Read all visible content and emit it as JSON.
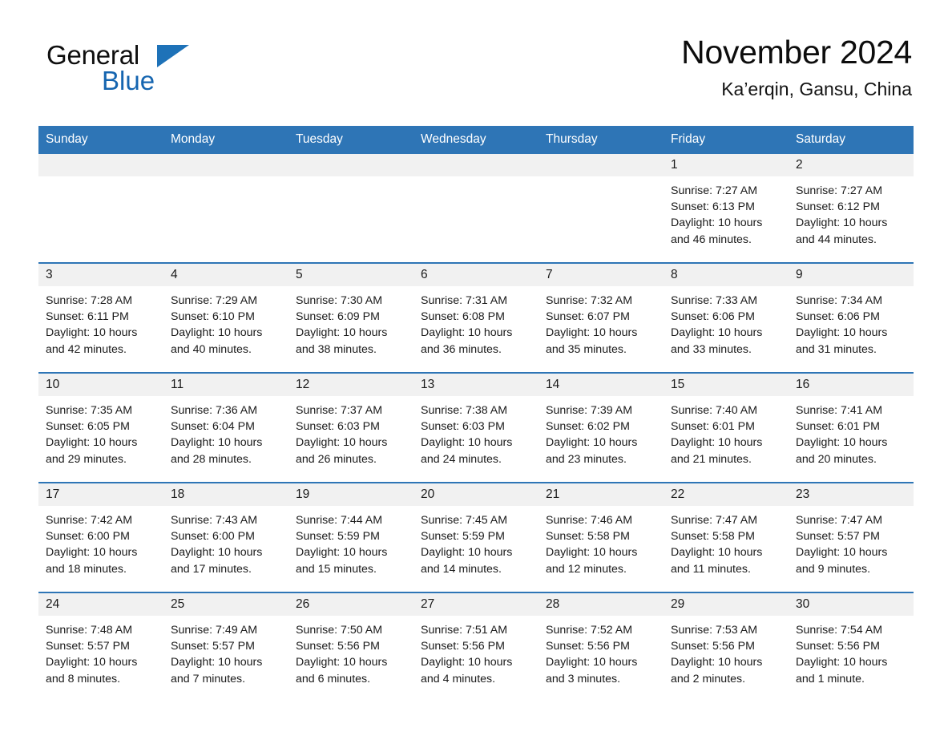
{
  "brand": {
    "name_part1": "General",
    "name_part2": "Blue",
    "logo_icon": "triangle-flag-icon",
    "accent_color": "#1e72b8"
  },
  "header": {
    "title": "November 2024",
    "subtitle": "Ka’erqin, Gansu, China"
  },
  "theme": {
    "header_row_color": "#2e75b6",
    "daynum_band_color": "#f1f1f1",
    "cell_border_color": "#2e75b6",
    "page_background": "#ffffff"
  },
  "weekday_headers": [
    "Sunday",
    "Monday",
    "Tuesday",
    "Wednesday",
    "Thursday",
    "Friday",
    "Saturday"
  ],
  "labels": {
    "sunrise_prefix": "Sunrise:",
    "sunset_prefix": "Sunset:",
    "daylight_prefix": "Daylight:"
  },
  "weeks": [
    [
      {
        "day": "",
        "empty": true
      },
      {
        "day": "",
        "empty": true
      },
      {
        "day": "",
        "empty": true
      },
      {
        "day": "",
        "empty": true
      },
      {
        "day": "",
        "empty": true
      },
      {
        "day": "1",
        "sunrise": "Sunrise: 7:27 AM",
        "sunset": "Sunset: 6:13 PM",
        "daylight": "Daylight: 10 hours and 46 minutes."
      },
      {
        "day": "2",
        "sunrise": "Sunrise: 7:27 AM",
        "sunset": "Sunset: 6:12 PM",
        "daylight": "Daylight: 10 hours and 44 minutes."
      }
    ],
    [
      {
        "day": "3",
        "sunrise": "Sunrise: 7:28 AM",
        "sunset": "Sunset: 6:11 PM",
        "daylight": "Daylight: 10 hours and 42 minutes."
      },
      {
        "day": "4",
        "sunrise": "Sunrise: 7:29 AM",
        "sunset": "Sunset: 6:10 PM",
        "daylight": "Daylight: 10 hours and 40 minutes."
      },
      {
        "day": "5",
        "sunrise": "Sunrise: 7:30 AM",
        "sunset": "Sunset: 6:09 PM",
        "daylight": "Daylight: 10 hours and 38 minutes."
      },
      {
        "day": "6",
        "sunrise": "Sunrise: 7:31 AM",
        "sunset": "Sunset: 6:08 PM",
        "daylight": "Daylight: 10 hours and 36 minutes."
      },
      {
        "day": "7",
        "sunrise": "Sunrise: 7:32 AM",
        "sunset": "Sunset: 6:07 PM",
        "daylight": "Daylight: 10 hours and 35 minutes."
      },
      {
        "day": "8",
        "sunrise": "Sunrise: 7:33 AM",
        "sunset": "Sunset: 6:06 PM",
        "daylight": "Daylight: 10 hours and 33 minutes."
      },
      {
        "day": "9",
        "sunrise": "Sunrise: 7:34 AM",
        "sunset": "Sunset: 6:06 PM",
        "daylight": "Daylight: 10 hours and 31 minutes."
      }
    ],
    [
      {
        "day": "10",
        "sunrise": "Sunrise: 7:35 AM",
        "sunset": "Sunset: 6:05 PM",
        "daylight": "Daylight: 10 hours and 29 minutes."
      },
      {
        "day": "11",
        "sunrise": "Sunrise: 7:36 AM",
        "sunset": "Sunset: 6:04 PM",
        "daylight": "Daylight: 10 hours and 28 minutes."
      },
      {
        "day": "12",
        "sunrise": "Sunrise: 7:37 AM",
        "sunset": "Sunset: 6:03 PM",
        "daylight": "Daylight: 10 hours and 26 minutes."
      },
      {
        "day": "13",
        "sunrise": "Sunrise: 7:38 AM",
        "sunset": "Sunset: 6:03 PM",
        "daylight": "Daylight: 10 hours and 24 minutes."
      },
      {
        "day": "14",
        "sunrise": "Sunrise: 7:39 AM",
        "sunset": "Sunset: 6:02 PM",
        "daylight": "Daylight: 10 hours and 23 minutes."
      },
      {
        "day": "15",
        "sunrise": "Sunrise: 7:40 AM",
        "sunset": "Sunset: 6:01 PM",
        "daylight": "Daylight: 10 hours and 21 minutes."
      },
      {
        "day": "16",
        "sunrise": "Sunrise: 7:41 AM",
        "sunset": "Sunset: 6:01 PM",
        "daylight": "Daylight: 10 hours and 20 minutes."
      }
    ],
    [
      {
        "day": "17",
        "sunrise": "Sunrise: 7:42 AM",
        "sunset": "Sunset: 6:00 PM",
        "daylight": "Daylight: 10 hours and 18 minutes."
      },
      {
        "day": "18",
        "sunrise": "Sunrise: 7:43 AM",
        "sunset": "Sunset: 6:00 PM",
        "daylight": "Daylight: 10 hours and 17 minutes."
      },
      {
        "day": "19",
        "sunrise": "Sunrise: 7:44 AM",
        "sunset": "Sunset: 5:59 PM",
        "daylight": "Daylight: 10 hours and 15 minutes."
      },
      {
        "day": "20",
        "sunrise": "Sunrise: 7:45 AM",
        "sunset": "Sunset: 5:59 PM",
        "daylight": "Daylight: 10 hours and 14 minutes."
      },
      {
        "day": "21",
        "sunrise": "Sunrise: 7:46 AM",
        "sunset": "Sunset: 5:58 PM",
        "daylight": "Daylight: 10 hours and 12 minutes."
      },
      {
        "day": "22",
        "sunrise": "Sunrise: 7:47 AM",
        "sunset": "Sunset: 5:58 PM",
        "daylight": "Daylight: 10 hours and 11 minutes."
      },
      {
        "day": "23",
        "sunrise": "Sunrise: 7:47 AM",
        "sunset": "Sunset: 5:57 PM",
        "daylight": "Daylight: 10 hours and 9 minutes."
      }
    ],
    [
      {
        "day": "24",
        "sunrise": "Sunrise: 7:48 AM",
        "sunset": "Sunset: 5:57 PM",
        "daylight": "Daylight: 10 hours and 8 minutes."
      },
      {
        "day": "25",
        "sunrise": "Sunrise: 7:49 AM",
        "sunset": "Sunset: 5:57 PM",
        "daylight": "Daylight: 10 hours and 7 minutes."
      },
      {
        "day": "26",
        "sunrise": "Sunrise: 7:50 AM",
        "sunset": "Sunset: 5:56 PM",
        "daylight": "Daylight: 10 hours and 6 minutes."
      },
      {
        "day": "27",
        "sunrise": "Sunrise: 7:51 AM",
        "sunset": "Sunset: 5:56 PM",
        "daylight": "Daylight: 10 hours and 4 minutes."
      },
      {
        "day": "28",
        "sunrise": "Sunrise: 7:52 AM",
        "sunset": "Sunset: 5:56 PM",
        "daylight": "Daylight: 10 hours and 3 minutes."
      },
      {
        "day": "29",
        "sunrise": "Sunrise: 7:53 AM",
        "sunset": "Sunset: 5:56 PM",
        "daylight": "Daylight: 10 hours and 2 minutes."
      },
      {
        "day": "30",
        "sunrise": "Sunrise: 7:54 AM",
        "sunset": "Sunset: 5:56 PM",
        "daylight": "Daylight: 10 hours and 1 minute."
      }
    ]
  ]
}
